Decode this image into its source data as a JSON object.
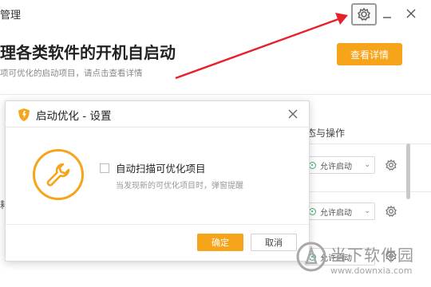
{
  "window": {
    "title": "管理",
    "headline": "理各类软件的开机自启动",
    "subline": "项可优化的启动项目，请点击查看详情",
    "detail_button": "查看详情",
    "column_header": "态与操作",
    "rows": [
      {
        "status": "允许启动"
      },
      {
        "status": "允许启动"
      },
      {
        "status": "允许启动"
      }
    ],
    "left_char": "耗"
  },
  "icons": {
    "settings": "gear-icon",
    "minimize": "minimize-icon",
    "close": "close-icon",
    "annotation_arrow": "red-arrow",
    "wrench": "wrench-icon",
    "shield": "shield-icon"
  },
  "dialog": {
    "title": "启动优化 - 设置",
    "option_label": "自动扫描可优化项目",
    "option_hint": "当发现新的可优化项目时，弹窗提醒",
    "ok_label": "确定",
    "cancel_label": "取消"
  },
  "watermark": {
    "name": "当下软件园",
    "url": "www.downxia.com"
  },
  "colors": {
    "accent": "#f6a41a",
    "arrow": "#e8202a",
    "status_green": "#3cb371"
  }
}
